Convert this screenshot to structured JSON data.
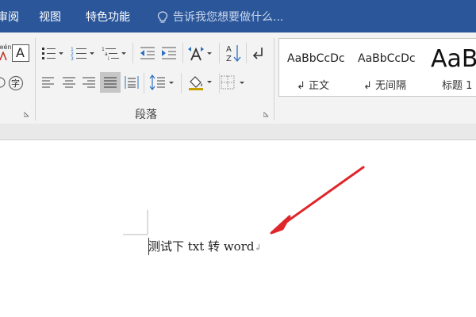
{
  "tabs": [
    {
      "label": "审阅"
    },
    {
      "label": "视图"
    },
    {
      "label": "特色功能"
    }
  ],
  "tell_me": {
    "placeholder": "告诉我您想要做什么..."
  },
  "font_group": {
    "ruby_glyph": "wén",
    "enclose_glyph": "字",
    "border_glyph": "A"
  },
  "paragraph_group": {
    "label": "段落"
  },
  "styles": [
    {
      "sample": "AaBbCcDc",
      "name": "↲ 正文"
    },
    {
      "sample": "AaBbCcDc",
      "name": "↲ 无间隔"
    },
    {
      "sample": "AaB",
      "name": "标题 1"
    }
  ],
  "document": {
    "text": "测试下 txt 转 word",
    "mark": "↲"
  },
  "colors": {
    "ribbon_blue": "#2b579a",
    "arrow_red": "#e0262b",
    "icon_blue": "#2f6fc0"
  }
}
